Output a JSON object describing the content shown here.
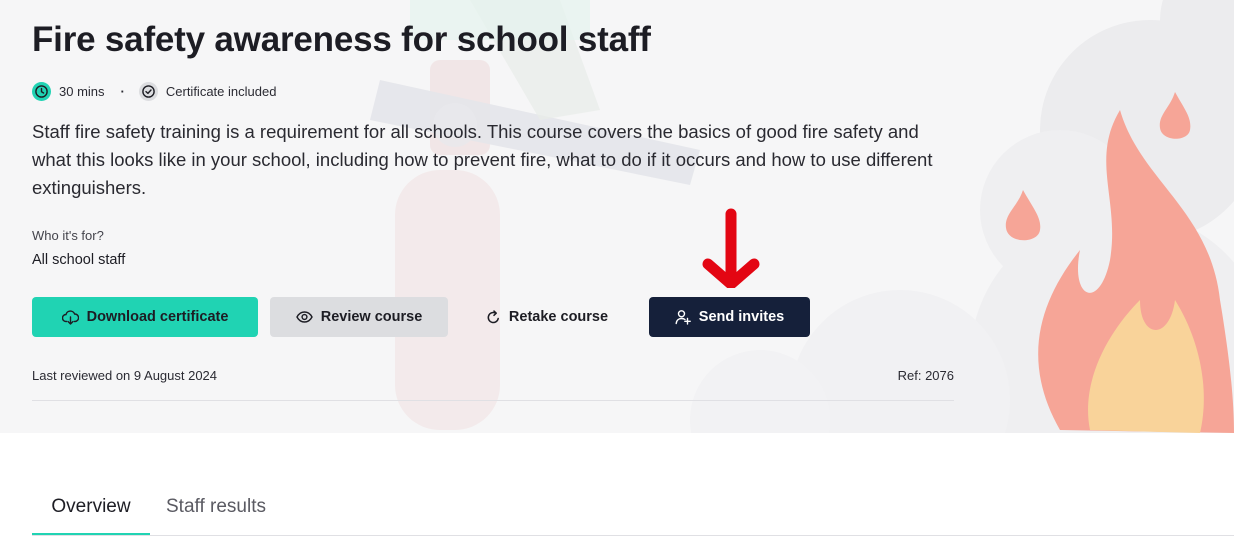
{
  "course": {
    "title": "Fire safety awareness for school staff",
    "duration": "30 mins",
    "certificate": "Certificate included",
    "description": "Staff fire safety training is a requirement for all schools. This course covers the basics of good fire safety and what this looks like in your school, including how to prevent fire, what to do if it occurs and how to use different extinguishers.",
    "who_label": "Who it's for?",
    "who_value": "All school staff",
    "last_reviewed": "Last reviewed on 9 August 2024",
    "ref": "Ref: 2076"
  },
  "actions": {
    "download": "Download certificate",
    "review": "Review course",
    "retake": "Retake course",
    "invite": "Send invites"
  },
  "tabs": [
    {
      "label": "Overview",
      "active": true
    },
    {
      "label": "Staff results",
      "active": false
    }
  ],
  "icons": {
    "duration": "clock-icon",
    "certificate": "check-circle-icon",
    "download": "cloud-download-icon",
    "review": "eye-icon",
    "retake": "refresh-icon",
    "invite": "user-add-icon",
    "annotation": "arrow-down-icon"
  },
  "colors": {
    "accent": "#20d3b3",
    "primary_dark": "#15203a",
    "annotation_red": "#e30613",
    "flame": "#f6a597"
  }
}
